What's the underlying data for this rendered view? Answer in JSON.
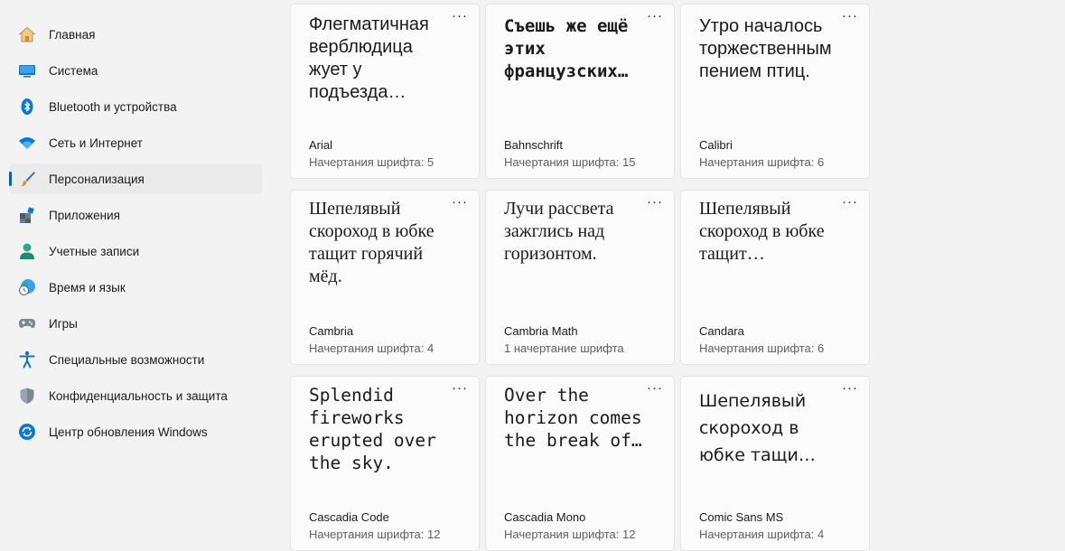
{
  "nav": {
    "items": [
      {
        "label": "Главная",
        "icon": "home-icon",
        "selected": false
      },
      {
        "label": "Система",
        "icon": "monitor-icon",
        "selected": false
      },
      {
        "label": "Bluetooth и устройства",
        "icon": "bluetooth-icon",
        "selected": false
      },
      {
        "label": "Сеть и Интернет",
        "icon": "wifi-icon",
        "selected": false
      },
      {
        "label": "Персонализация",
        "icon": "brush-icon",
        "selected": true
      },
      {
        "label": "Приложения",
        "icon": "apps-icon",
        "selected": false
      },
      {
        "label": "Учетные записи",
        "icon": "account-icon",
        "selected": false
      },
      {
        "label": "Время и язык",
        "icon": "globe-clock-icon",
        "selected": false
      },
      {
        "label": "Игры",
        "icon": "gamepad-icon",
        "selected": false
      },
      {
        "label": "Специальные возможности",
        "icon": "accessibility-icon",
        "selected": false
      },
      {
        "label": "Конфиденциальность и защита",
        "icon": "shield-icon",
        "selected": false
      },
      {
        "label": "Центр обновления Windows",
        "icon": "update-icon",
        "selected": false
      }
    ]
  },
  "fonts": {
    "more_label": "···",
    "cards": [
      {
        "sample": "Флегматичная верблюдица жует у подъезда…",
        "name": "Arial",
        "styles": "Начертания шрифта: 5"
      },
      {
        "sample": "Съешь же ещё этих французских…",
        "name": "Bahnschrift",
        "styles": "Начертания шрифта: 15"
      },
      {
        "sample": "Утро началось торжественным пением птиц.",
        "name": "Calibri",
        "styles": "Начертания шрифта: 6"
      },
      {
        "sample": "Шепелявый скороход в юбке тащит горячий мёд.",
        "name": "Cambria",
        "styles": "Начертания шрифта: 4"
      },
      {
        "sample": "Лучи рассвета зажглись над горизонтом.",
        "name": "Cambria Math",
        "styles": "1 начертание шрифта"
      },
      {
        "sample": "Шепелявый скороход в юбке тащит…",
        "name": "Candara",
        "styles": "Начертания шрифта: 6"
      },
      {
        "sample": "Splendid fireworks erupted over the sky.",
        "name": "Cascadia Code",
        "styles": "Начертания шрифта: 12"
      },
      {
        "sample": "Over the horizon comes the break of…",
        "name": "Cascadia Mono",
        "styles": "Начертания шрифта: 12"
      },
      {
        "sample": "Шепелявый скороход в юбке тащи…",
        "name": "Comic Sans MS",
        "styles": "Начертания шрифта: 4"
      }
    ]
  }
}
